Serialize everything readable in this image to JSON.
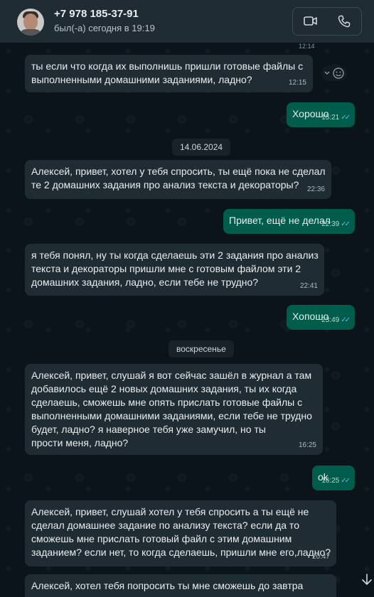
{
  "header": {
    "contact_name": "+7 978 185-37-91",
    "status": "был(-а) сегодня в 19:19"
  },
  "icons": {
    "video_call": "video-camera-icon",
    "voice_call": "phone-icon",
    "reaction": "smiley-icon",
    "scroll_down": "arrow-down-icon"
  },
  "colors": {
    "incoming_bubble": "#202c33",
    "outgoing_bubble": "#005c4b",
    "read_ticks": "#53bdeb"
  },
  "chat": {
    "peek_time": "12:14",
    "messages": [
      {
        "text": "ты если что когда их выполнишь пришли готовые файлы с\nвыполненными домашними заданиями, ладно?",
        "time": "12:15"
      },
      {
        "text": "Хорошо",
        "time": "15:21"
      },
      {
        "text": "Алексей, привет, хотел у тебя спросить, ты ещё пока не сделал\nте 2 домашних задания про анализ текста и декораторы?",
        "time": "22:36"
      },
      {
        "text": "Привет, ещё не делал",
        "time": "22:39"
      },
      {
        "text": "я тебя понял, ну ты когда сделаешь эти 2 задания про анализ\nтекста и декораторы пришли мне с готовым файлом эти 2\nдомашних задания, ладно, если тебе не трудно?",
        "time": "22:41"
      },
      {
        "text": "Хопошо",
        "time": "23:49"
      },
      {
        "text": "Алексей, привет, слушай я вот сейчас зашёл в журнал а там\nдобавилось ещё 2 новых домашних задания, ты их когда\nсделаешь, сможешь мне опять прислать готовые файлы с\nвыполненными домашними заданиями, если тебе не трудно\nбудет, ладно? я наверное тебя уже замучил, но ты\nпрости меня, ладно?",
        "time": "16:25"
      },
      {
        "text": "ok",
        "time": "16:25"
      },
      {
        "text": "Алексей, привет, слушай хотел у тебя спросить а ты ещё не\nсделал домашнее задание по анализу текста? если да то\nсможешь мне прислать готовый файл с этим домашним\nзаданием? если нет, то когда сделаешь, пришли мне его,ладно?",
        "time": "20:47"
      },
      {
        "text": "Алексей, хотел тебя попросить ты мне сможешь до завтра",
        "time": ""
      }
    ],
    "date_dividers": [
      "14.06.2024",
      "воскресенье"
    ],
    "ticks": "✓✓"
  }
}
